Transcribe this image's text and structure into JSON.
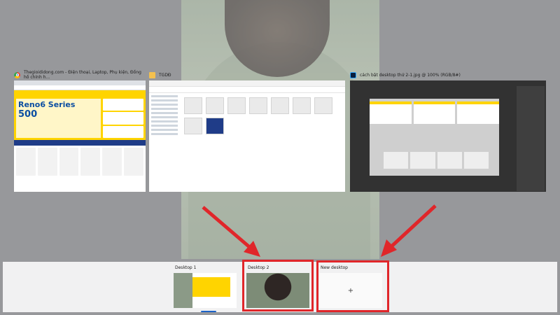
{
  "windows": [
    {
      "title": "Thegioididong.com - Điện thoại, Laptop, Phụ kiện, Đồng hồ chính h...",
      "icon": "chrome-icon",
      "content": {
        "headline": "Reno6 Series",
        "price": "500"
      }
    },
    {
      "title": "TGDĐ",
      "icon": "folder-icon"
    },
    {
      "title": "cách bật desktop thứ 2-1.jpg @ 100% (RGB/8#)",
      "icon": "photoshop-icon"
    }
  ],
  "desktops": [
    {
      "label": "Desktop 1",
      "active": true
    },
    {
      "label": "Desktop 2",
      "active": false
    },
    {
      "label": "New desktop",
      "is_new": true,
      "plus": "+"
    }
  ],
  "annotation": {
    "highlight_color": "#e0262a",
    "arrow_color": "#e0262a"
  }
}
